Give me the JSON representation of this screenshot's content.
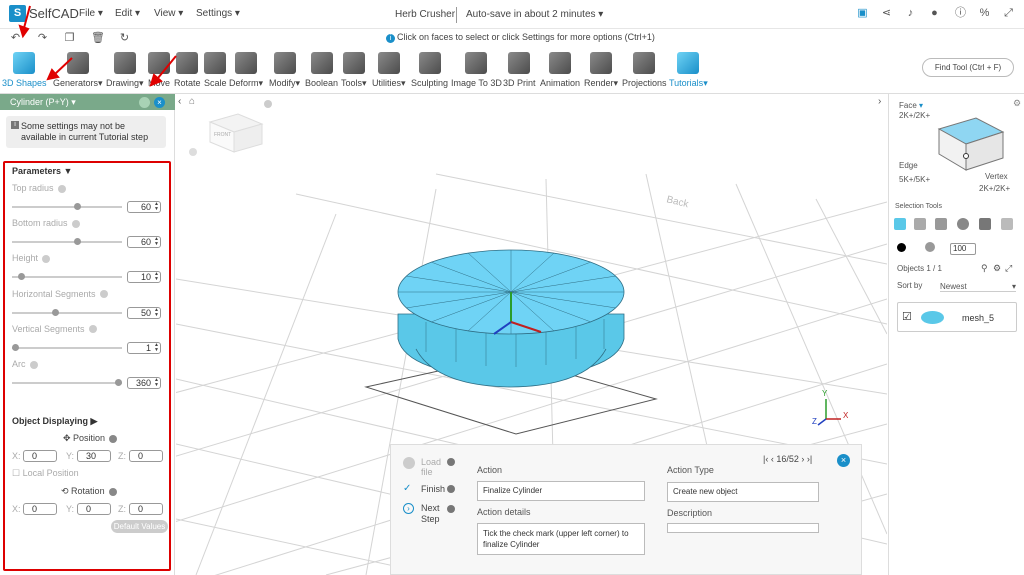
{
  "app": {
    "logo_text": "SelfCAD",
    "menus": [
      "File",
      "Edit",
      "View",
      "Settings"
    ],
    "project_title": "Herb Crusher",
    "autosave": "Auto-save in about 2 minutes",
    "hint": "Click on faces to select or click Settings for more options (Ctrl+1)"
  },
  "toolbar": {
    "tools": [
      "3D Shapes",
      "Generators",
      "Drawing",
      "Move",
      "Rotate",
      "Scale",
      "Deform",
      "Modify",
      "Boolean",
      "Tools",
      "Utilities",
      "Sculpting",
      "Image To 3D",
      "3D Print",
      "Animation",
      "Render",
      "Projections",
      "Tutorials"
    ],
    "find_tool": "Find Tool (Ctrl + F)"
  },
  "panel": {
    "title": "Cylinder (P+Y)",
    "warning": "Some settings may not be available in current Tutorial step",
    "section": "Parameters",
    "params": [
      {
        "label": "Top radius",
        "value": "60",
        "fill": 0.6
      },
      {
        "label": "Bottom radius",
        "value": "60",
        "fill": 0.6
      },
      {
        "label": "Height",
        "value": "10",
        "fill": 0.06
      },
      {
        "label": "Horizontal Segments",
        "value": "50",
        "fill": 0.39
      },
      {
        "label": "Vertical Segments",
        "value": "1",
        "fill": 0.0
      },
      {
        "label": "Arc",
        "value": "360",
        "fill": 1.0
      }
    ],
    "object_displaying": "Object Displaying",
    "position_label": "Position",
    "position": {
      "x": "0",
      "y": "30",
      "z": "0"
    },
    "local_position": "Local Position",
    "rotation_label": "Rotation",
    "rotation": {
      "x": "0",
      "y": "0",
      "z": "0"
    },
    "default_values": "Default Values",
    "axis_x": "X:",
    "axis_y": "Y:",
    "axis_z": "Z:"
  },
  "viewport": {
    "view_cube_text": "FRONT",
    "axis_labels": {
      "x": "X",
      "y": "Y",
      "z": "Z"
    },
    "floor_text": "Back"
  },
  "right_panel": {
    "face": "Face",
    "face_keys": "2K+/2K+",
    "edge": "Edge",
    "edge_keys": "5K+/5K+",
    "vertex": "Vertex",
    "vertex_keys": "2K+/2K+",
    "selection_tools": "Selection Tools",
    "opacity": "100",
    "objects_count": "Objects 1 / 1",
    "sort_by": "Sort by",
    "sort_value": "Newest",
    "mesh_name": "mesh_5"
  },
  "tutorial": {
    "steps": [
      "Load file",
      "Finish",
      "Next Step"
    ],
    "pager": "16/52",
    "action_label": "Action",
    "action_value": "Finalize Cylinder",
    "action_details_label": "Action details",
    "action_details": "Tick the check mark (upper left corner) to finalize Cylinder",
    "action_type_label": "Action Type",
    "action_type_value": "Create new object",
    "description_label": "Description"
  },
  "colors": {
    "accent": "#1a8fc9",
    "panel_header": "#7aa98a",
    "highlight_border": "#dd0000",
    "mesh": "#5ac8e8"
  }
}
